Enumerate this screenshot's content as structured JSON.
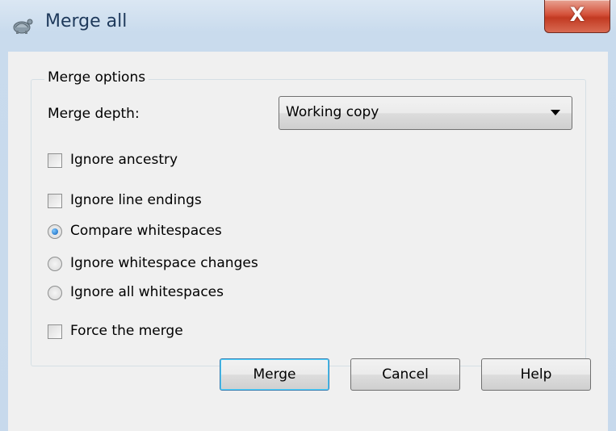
{
  "window": {
    "title": "Merge all",
    "close_glyph": "X"
  },
  "group": {
    "label": "Merge options",
    "depth_label": "Merge depth:",
    "depth_value": "Working copy"
  },
  "options": {
    "ignore_ancestry": {
      "label": "Ignore ancestry",
      "checked": false
    },
    "ignore_line_endings": {
      "label": "Ignore line endings",
      "checked": false
    },
    "compare_whitespaces": {
      "label": "Compare whitespaces",
      "selected": true
    },
    "ignore_whitespace_changes": {
      "label": "Ignore whitespace changes",
      "selected": false
    },
    "ignore_all_whitespaces": {
      "label": "Ignore all whitespaces",
      "selected": false
    },
    "force_merge": {
      "label": "Force the merge",
      "checked": false
    }
  },
  "buttons": {
    "merge": "Merge",
    "cancel": "Cancel",
    "help": "Help"
  },
  "icons": {
    "app": "tortoise-icon",
    "close": "close-icon",
    "dropdown": "chevron-down-icon"
  },
  "colors": {
    "title_text": "#1e395b",
    "close_button": "#c23a22",
    "dialog_bg": "#f0f0f0",
    "radio_dot": "#0b5eb8"
  }
}
